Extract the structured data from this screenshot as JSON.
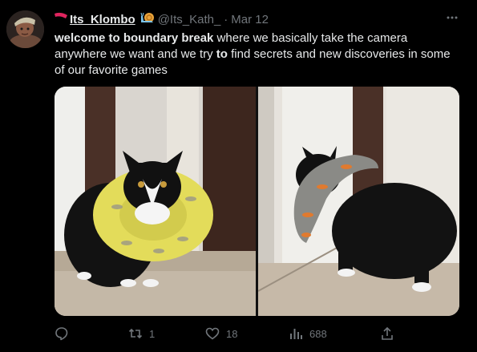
{
  "post": {
    "display_name": "Its_Klombo",
    "name_emoji": "snail-emoji",
    "handle": "@Its_Kath_",
    "separator": "·",
    "date": "Mar 12",
    "more_icon": "more-horizontal-icon",
    "text": {
      "bold_1": "welcome to boundary break",
      "plain_1": " where we basically take the camera anywhere we want and we try ",
      "bold_2": "to",
      "plain_2": " find secrets and new discoveries in some of our favorite games"
    },
    "media": {
      "count": 2,
      "photos": [
        {
          "icon": "cat-cone-photo-front"
        },
        {
          "icon": "cat-cone-photo-side"
        }
      ]
    },
    "actions": {
      "reply": {
        "icon": "reply-icon",
        "count": ""
      },
      "repost": {
        "icon": "repost-icon",
        "count": "1"
      },
      "like": {
        "icon": "heart-icon",
        "count": "18"
      },
      "views": {
        "icon": "views-icon",
        "count": "688"
      },
      "share": {
        "icon": "share-icon",
        "count": ""
      }
    },
    "colors": {
      "background": "#000000",
      "text_primary": "#e7e9ea",
      "text_secondary": "#71767b",
      "name_flag": "#e0245e"
    }
  }
}
